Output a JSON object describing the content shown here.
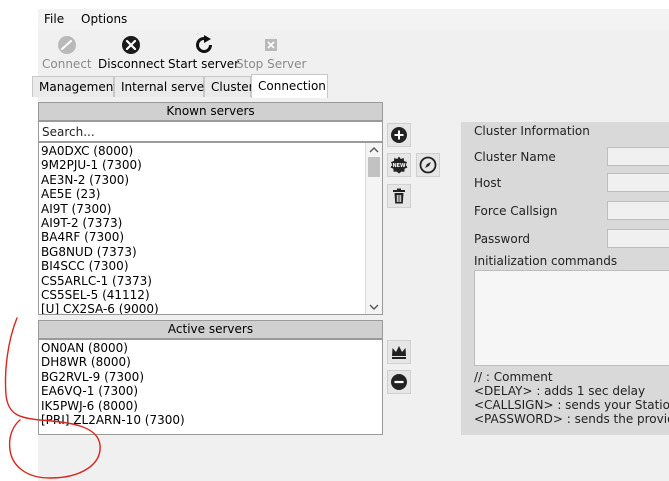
{
  "menu": {
    "file": "File",
    "options": "Options"
  },
  "toolbar": {
    "connect": "Connect",
    "disconnect": "Disconnect",
    "start_server": "Start server",
    "stop_server": "Stop Server"
  },
  "tabs": [
    "Management",
    "Internal server",
    "Cluster",
    "Connection"
  ],
  "known_servers": {
    "header": "Known servers",
    "search_placeholder": "Search...",
    "items": [
      "9A0DXC (8000)",
      "9M2PJU-1 (7300)",
      "AE3N-2 (7300)",
      "AE5E (23)",
      "AI9T (7300)",
      "AI9T-2 (7373)",
      "BA4RF (7300)",
      "BG8NUD (7373)",
      "BI4SCC (7300)",
      "CS5ARLC-1 (7373)",
      "CS5SEL-5 (41112)",
      "[U] CX2SA-6 (9000)"
    ]
  },
  "active_servers": {
    "header": "Active servers",
    "items": [
      "ON0AN (8000)",
      "DH8WR (8000)",
      "BG2RVL-9 (7300)",
      "EA6VQ-1 (7300)",
      "IK5PWJ-6 (8000)",
      "[PRI] ZL2ARN-10 (7300)"
    ]
  },
  "cluster_info": {
    "title": "Cluster Information",
    "name_label": "Cluster Name",
    "host_label": "Host",
    "callsign_label": "Force Callsign",
    "password_label": "Password",
    "init_label": "Initialization commands",
    "help": [
      "// : Comment",
      "<DELAY> : adds 1 sec delay",
      "<CALLSIGN> : sends your Station C",
      "<PASSWORD> : sends the provided"
    ]
  },
  "icons": {
    "add": "plus-circle-icon",
    "new": "new-badge-icon",
    "edit": "compass-icon",
    "delete": "trash-icon",
    "make_primary": "crown-icon",
    "remove": "minus-circle-icon"
  },
  "colors": {
    "annotation": "#d9261c"
  }
}
